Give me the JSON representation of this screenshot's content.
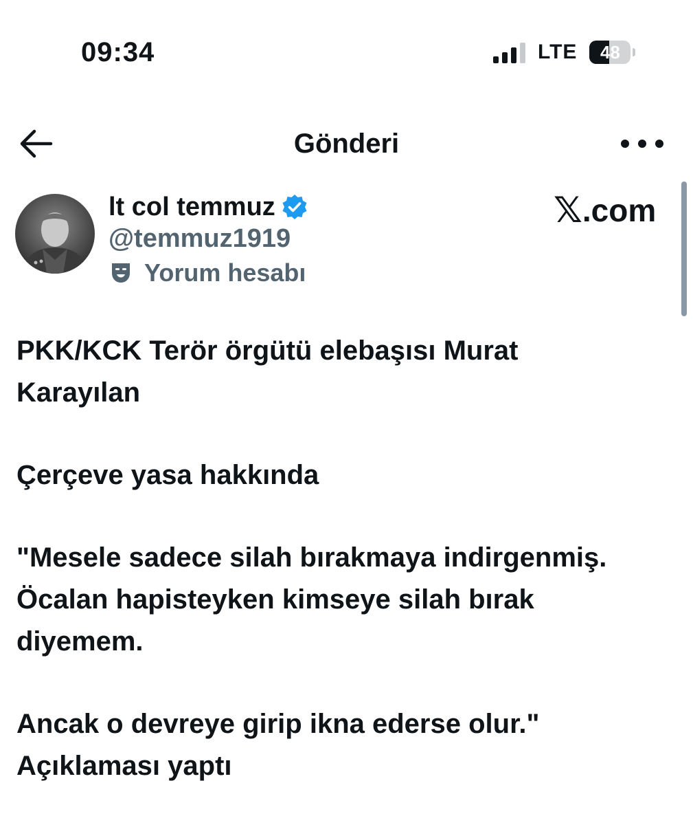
{
  "status_bar": {
    "time": "09:34",
    "network": "LTE",
    "battery": "48",
    "battery_level": 0.48,
    "signal_bars_filled": 3,
    "signal_bars_total": 4
  },
  "nav": {
    "title": "Gönderi",
    "back_icon": "arrow-left-icon",
    "more_icon": "more-horizontal-icon"
  },
  "author": {
    "display_name": "lt col temmuz",
    "handle": "@temmuz1919",
    "account_label": "Yorum hesabı",
    "label_icon": "theater-mask-icon",
    "verified_icon": "verified-badge-icon",
    "verified_color": "#1d9bf0"
  },
  "watermark": {
    "x": "𝕏",
    "suffix": ".com"
  },
  "tweet": {
    "paragraphs": [
      [
        "PKK/KCK Terör örgütü elebaşısı Murat",
        "Karayılan"
      ],
      [
        "Çerçeve yasa hakkında"
      ],
      [
        "\"Mesele sadece silah bırakmaya indirgenmiş.",
        "Öcalan hapisteyken kimseye silah bırak",
        "diyemem."
      ],
      [
        "Ancak o devreye girip ikna ederse olur.\"",
        "Açıklaması yaptı"
      ]
    ]
  },
  "colors": {
    "text": "#0f1419",
    "secondary": "#536471",
    "accent": "#1d9bf0"
  }
}
